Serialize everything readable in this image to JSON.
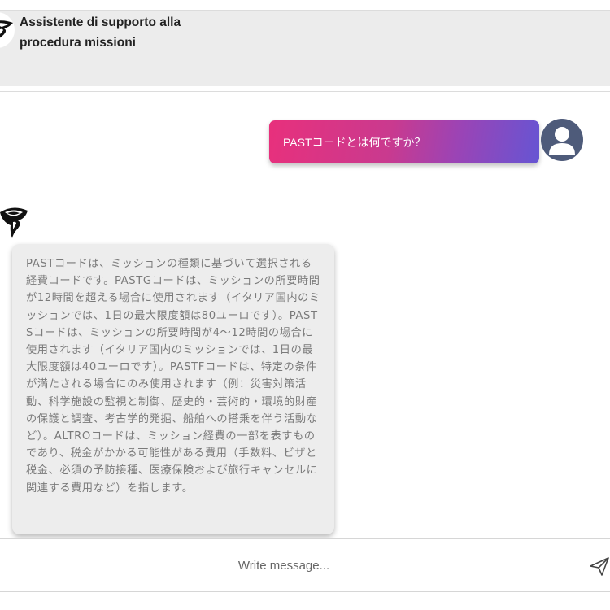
{
  "header": {
    "title": "Assistente di supporto alla procedura missioni",
    "logo_icon": "spiral-logo-icon"
  },
  "conversation": {
    "user_message": {
      "text": "PASTコードとは何ですか？",
      "avatar_icon": "user-silhouette-icon",
      "gradient_colors": [
        "#e8307c",
        "#6655d3"
      ]
    },
    "bot_message": {
      "avatar_icon": "spiral-logo-icon",
      "text": "PASTコードは、ミッションの種類に基づいて選択される経費コードです。PASTGコードは、ミッションの所要時間が12時間を超える場合に使用されます（イタリア国内のミッションでは、1日の最大限度額は80ユーロです）。PASTSコードは、ミッションの所要時間が4〜12時間の場合に使用されます（イタリア国内のミッションでは、1日の最大限度額は40ユーロです）。PASTFコードは、特定の条件が満たされる場合にのみ使用されます（例：災害対策活動、科学施設の監視と制御、歴史的・芸術的・環境的財産の保護と調査、考古学的発掘、船舶への搭乗を伴う活動など）。ALTROコードは、ミッション経費の一部を表すものであり、税金がかかる可能性がある費用（手数料、ビザと税金、必須の予防接種、医療保険および旅行キャンセルに関連する費用など）を指します。"
    }
  },
  "composer": {
    "placeholder": "Write message...",
    "send_icon": "send-icon"
  }
}
